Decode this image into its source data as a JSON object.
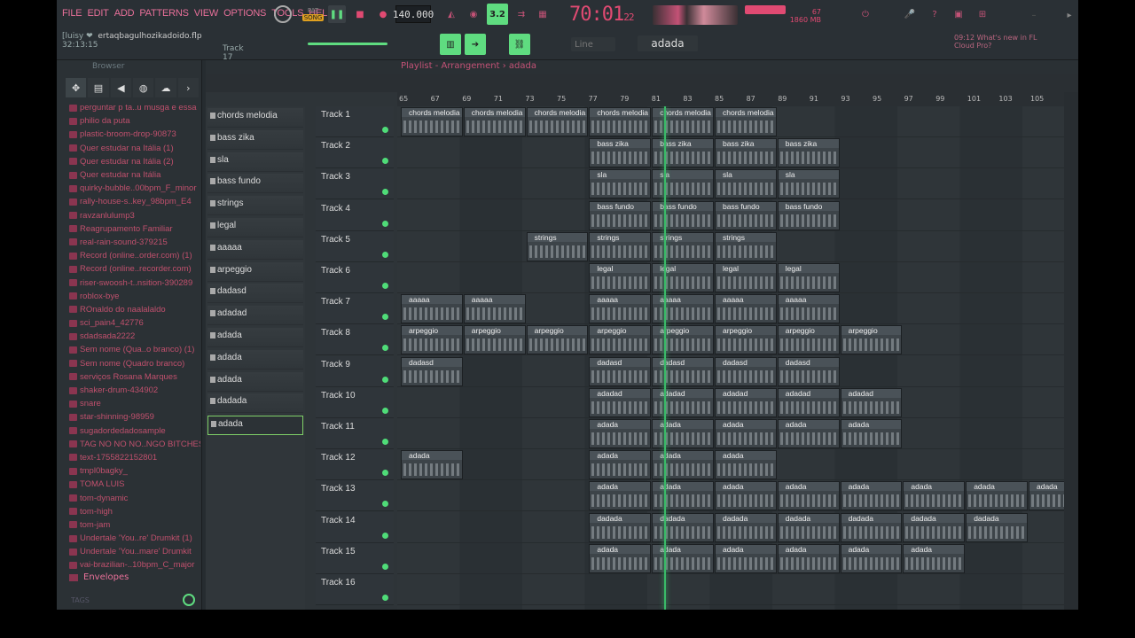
{
  "menu": [
    "FILE",
    "EDIT",
    "ADD",
    "PATTERNS",
    "VIEW",
    "OPTIONS",
    "TOOLS",
    "HELP"
  ],
  "transport": {
    "pat": "PAT",
    "song": "SONG",
    "tempo": "140.000",
    "time": "70:01",
    "time_sub": "22",
    "meter": "3.2",
    "cpu": "1860 MB",
    "poly": "67",
    "polyR": "0"
  },
  "project": {
    "user": "[luisy ❤",
    "file": "ertaqbagulhozikadoido.flp",
    "clock": "32:13:15",
    "track_hint": "Track 17"
  },
  "channel": {
    "snap": "Line",
    "pattern": "adada",
    "news": "09:12  What's new in FL Cloud Pro?"
  },
  "browser": {
    "title": "Browser",
    "items": [
      "perguntar p ta..u musga e essa",
      "philio da puta",
      "plastic-broom-drop-90873",
      "Quer estudar na Itália (1)",
      "Quer estudar na Itália (2)",
      "Quer estudar na Itália",
      "quirky-bubble..00bpm_F_minor",
      "rally-house-s..key_98bpm_E4",
      "ravzanlulump3",
      "Reagrupamento Familiar",
      "real-rain-sound-379215",
      "Record (online..order.com) (1)",
      "Record (online..recorder.com)",
      "riser-swoosh-t..nsition-390289",
      "roblox-bye",
      "ROnaldo do naalalaldo",
      "sci_pain4_42776",
      "sdadsada2222",
      "Sem nome (Qua..o branco) (1)",
      "Sem nome (Quadro branco)",
      "serviços Rosana Marques",
      "shaker-drum-434902",
      "snare",
      "star-shinning-98959",
      "sugadordedadosample",
      "TAG NO NO NO..NGO BITCHES",
      "text-1755822152801",
      "tmpl0bagky_",
      "TOMA LUIS",
      "tom-dynamic",
      "tom-high",
      "tom-jam",
      "Undertale 'You..re' Drumkit (1)",
      "Undertale 'You..mare' Drumkit",
      "vai-brazilian-..10bpm_C_major"
    ],
    "envelopes": "Envelopes",
    "tags": "TAGS"
  },
  "playlist": {
    "title": "Playlist - Arrangement › adada",
    "patterns": [
      "chords melodia",
      "bass zika",
      "sla",
      "bass fundo",
      "strings",
      "legal",
      "aaaaa",
      "arpeggio",
      "dadasd",
      "adadad",
      "adada",
      "adada",
      "adada",
      "dadada",
      "adada"
    ],
    "tracks": [
      "Track 1",
      "Track 2",
      "Track 3",
      "Track 4",
      "Track 5",
      "Track 6",
      "Track 7",
      "Track 8",
      "Track 9",
      "Track 10",
      "Track 11",
      "Track 12",
      "Track 13",
      "Track 14",
      "Track 15",
      "Track 16"
    ],
    "ruler": [
      "65",
      "67",
      "69",
      "71",
      "73",
      "75",
      "77",
      "79",
      "81",
      "83",
      "85",
      "87",
      "89",
      "91",
      "93",
      "95",
      "97",
      "99",
      "101",
      "103",
      "105"
    ],
    "clips": [
      {
        "t": 0,
        "name": "chords melodia",
        "bars": [
          0,
          1,
          2,
          3,
          4,
          5
        ]
      },
      {
        "t": 1,
        "name": "bass zika",
        "bars": [
          3,
          4,
          5,
          6
        ]
      },
      {
        "t": 2,
        "name": "sla",
        "bars": [
          3,
          4,
          5,
          6
        ]
      },
      {
        "t": 3,
        "name": "bass fundo",
        "bars": [
          3,
          4,
          5,
          6
        ]
      },
      {
        "t": 4,
        "name": "strings",
        "bars": [
          2,
          3,
          4,
          5
        ]
      },
      {
        "t": 5,
        "name": "legal",
        "bars": [
          3,
          4,
          5,
          6
        ]
      },
      {
        "t": 6,
        "name": "aaaaa",
        "bars": [
          0,
          1,
          3,
          4,
          5,
          6
        ]
      },
      {
        "t": 7,
        "name": "arpeggio",
        "bars": [
          0,
          1,
          2,
          3,
          4,
          5,
          6,
          7
        ]
      },
      {
        "t": 8,
        "name": "dadasd",
        "bars": [
          0,
          3,
          4,
          5,
          6
        ]
      },
      {
        "t": 9,
        "name": "adadad",
        "bars": [
          3,
          4,
          5,
          6,
          7
        ]
      },
      {
        "t": 10,
        "name": "adada",
        "bars": [
          3,
          4,
          5,
          6,
          7
        ]
      },
      {
        "t": 11,
        "name": "adada",
        "bars": [
          0,
          3,
          4,
          5
        ]
      },
      {
        "t": 12,
        "name": "adada",
        "bars": [
          3,
          4,
          5,
          6,
          7,
          8,
          9,
          10
        ]
      },
      {
        "t": 13,
        "name": "dadada",
        "bars": [
          3,
          4,
          5,
          6,
          7,
          8,
          9
        ]
      },
      {
        "t": 14,
        "name": "adada",
        "bars": [
          3,
          4,
          5,
          6,
          7,
          8
        ]
      }
    ]
  },
  "colors": {
    "accent": "#e04a72",
    "green": "#4fdc78",
    "brand": "#c35276"
  }
}
